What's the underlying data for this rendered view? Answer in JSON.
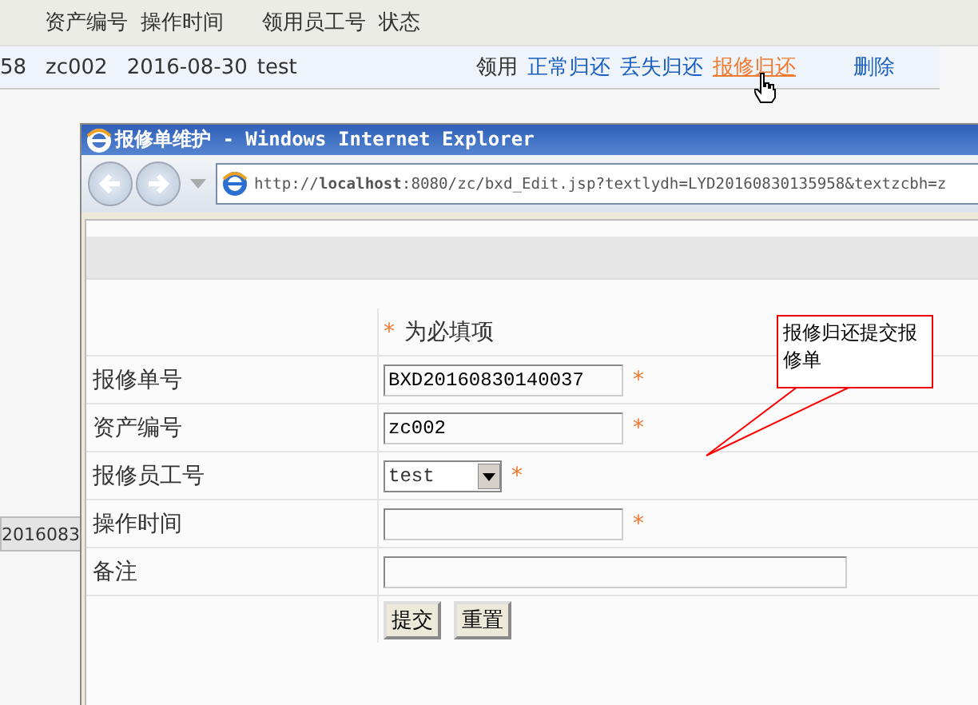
{
  "background_table": {
    "columns": [
      "资产编号",
      "操作时间",
      "领用员工号",
      "状态"
    ],
    "row": {
      "cells": [
        "58",
        "zc002",
        "2016-08-30",
        "test"
      ],
      "status": "领用",
      "actions": [
        {
          "label": "正常归还",
          "hovered": false
        },
        {
          "label": "丢失归还",
          "hovered": false
        },
        {
          "label": "报修归还",
          "hovered": true
        },
        {
          "label": "删除",
          "hovered": false
        }
      ]
    },
    "hidden_cell": "2016083"
  },
  "popup": {
    "title": "报修单维护 - Windows Internet Explorer",
    "address": "http://**localhost**:8080/zc/bxd_Edit.jsp?textlydh=LYD20160830135958&textzcbh=z",
    "form": {
      "required_note": {
        "mark": "*",
        "text": "为必填项"
      },
      "fields": [
        {
          "label": "报修单号",
          "kind": "text",
          "value": "BXD20160830140037",
          "required": true
        },
        {
          "label": "资产编号",
          "kind": "text",
          "value": "zc002",
          "required": true
        },
        {
          "label": "报修员工号",
          "kind": "select",
          "value": "test",
          "required": true
        },
        {
          "label": "操作时间",
          "kind": "text",
          "required": true
        },
        {
          "label": "备注",
          "kind": "wide",
          "required": false
        }
      ],
      "buttons": [
        "提交",
        "重置"
      ]
    },
    "callout": {
      "text": "报修归还提交报修单"
    }
  }
}
